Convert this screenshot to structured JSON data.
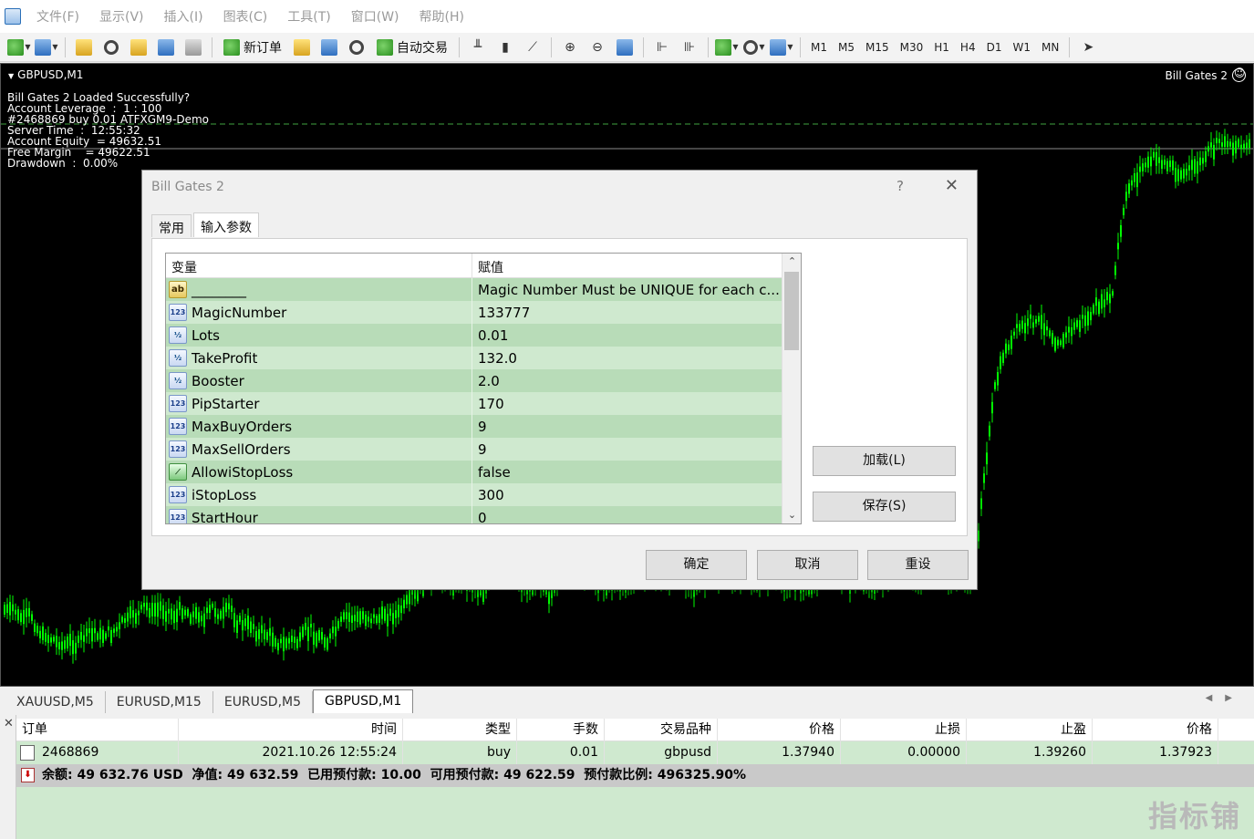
{
  "menu": [
    "文件(F)",
    "显示(V)",
    "插入(I)",
    "图表(C)",
    "工具(T)",
    "窗口(W)",
    "帮助(H)"
  ],
  "toolbar": {
    "new_order": "新订单",
    "auto_trading": "自动交易",
    "timeframes": [
      "M1",
      "M5",
      "M15",
      "M30",
      "H1",
      "H4",
      "D1",
      "W1",
      "MN"
    ]
  },
  "chart": {
    "title": "GBPUSD,M1",
    "ea_name": "Bill Gates 2",
    "info": [
      "Bill Gates 2 Loaded Successfully?",
      "Account Leverage  :  1 : 100",
      "#2468869 buy 0.01 ATFXGM9-Demo",
      "Server Time  :  12:55:32",
      "Account Equity  = 49632.51",
      "Free Margin    = 49622.51",
      "Drawdown  :  0.00%"
    ],
    "line_color": "#00ff00"
  },
  "dialog": {
    "title": "Bill Gates 2",
    "help": "?",
    "tabs": [
      "常用",
      "输入参数"
    ],
    "headers": [
      "变量",
      "赋值"
    ],
    "params": [
      {
        "type": "ab",
        "name": "________",
        "value": "Magic Number Must be UNIQUE for each c..."
      },
      {
        "type": "123",
        "name": "MagicNumber",
        "value": "133777"
      },
      {
        "type": "v2",
        "name": "Lots",
        "value": "0.01"
      },
      {
        "type": "v2",
        "name": "TakeProfit",
        "value": "132.0"
      },
      {
        "type": "v2",
        "name": "Booster",
        "value": "2.0"
      },
      {
        "type": "123",
        "name": "PipStarter",
        "value": "170"
      },
      {
        "type": "123",
        "name": "MaxBuyOrders",
        "value": "9"
      },
      {
        "type": "123",
        "name": "MaxSellOrders",
        "value": "9"
      },
      {
        "type": "bool",
        "name": "AllowiStopLoss",
        "value": "false"
      },
      {
        "type": "123",
        "name": "iStopLoss",
        "value": "300"
      },
      {
        "type": "123",
        "name": "StartHour",
        "value": "0"
      }
    ],
    "load_btn": "加载(L)",
    "save_btn": "保存(S)",
    "ok_btn": "确定",
    "cancel_btn": "取消",
    "reset_btn": "重设"
  },
  "chart_tabs": [
    "XAUUSD,M5",
    "EURUSD,M15",
    "EURUSD,M5",
    "GBPUSD,M1"
  ],
  "terminal": {
    "headers": [
      "订单",
      "时间",
      "类型",
      "手数",
      "交易品种",
      "价格",
      "止损",
      "止盈",
      "价格"
    ],
    "row": [
      "2468869",
      "2021.10.26 12:55:24",
      "buy",
      "0.01",
      "gbpusd",
      "1.37940",
      "0.00000",
      "1.39260",
      "1.37923"
    ],
    "summary": "余额: 49 632.76 USD  净值: 49 632.59  已用预付款: 10.00  可用预付款: 49 622.59  预付款比例: 496325.90%"
  },
  "watermark": "指标铺"
}
